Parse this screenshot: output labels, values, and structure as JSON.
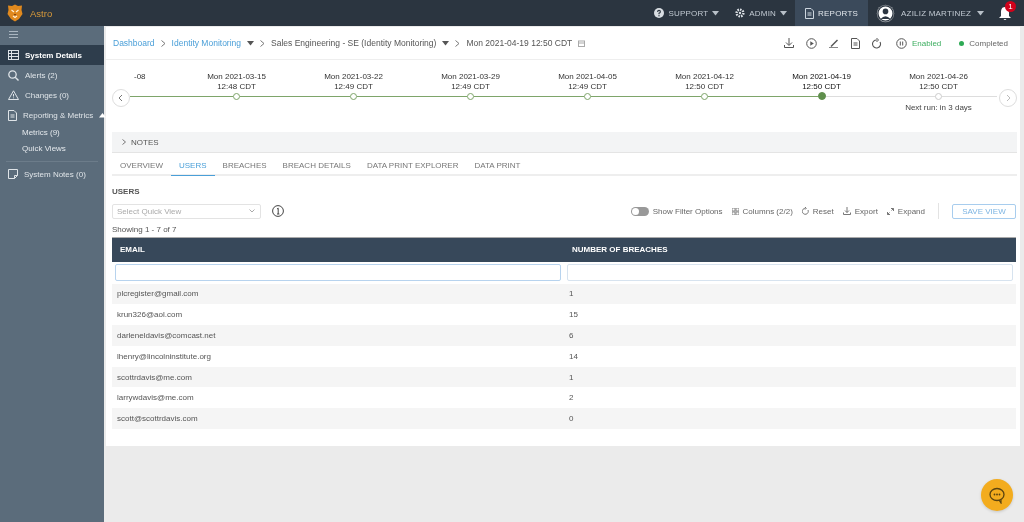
{
  "topbar": {
    "app_name": "Astro",
    "nav": [
      {
        "label": "SUPPORT",
        "kind": "help",
        "selected": false,
        "dropdown": true
      },
      {
        "label": "ADMIN",
        "kind": "gear",
        "selected": false,
        "dropdown": true
      },
      {
        "label": "REPORTS",
        "kind": "report",
        "selected": true,
        "dropdown": false
      }
    ],
    "user": "AZILIZ MARTINEZ",
    "notification_count": "1"
  },
  "sidebar": {
    "items": [
      {
        "label": "System Details",
        "selected": true
      },
      {
        "label": "Alerts (2)",
        "selected": false
      },
      {
        "label": "Changes (0)",
        "selected": false
      },
      {
        "label": "Reporting & Metrics",
        "selected": false,
        "expanded": true,
        "children": [
          {
            "label": "Metrics (9)",
            "selected": false
          },
          {
            "label": "Quick Views",
            "selected": false
          }
        ]
      },
      {
        "label": "System Notes (0)",
        "selected": false
      }
    ]
  },
  "breadcrumb": [
    {
      "label": "Dashboard",
      "link": true,
      "dropdown": false
    },
    {
      "label": "Identity Monitoring",
      "link": true,
      "dropdown": true
    },
    {
      "label": "Sales Engineering - SE (Identity Monitoring)",
      "link": false,
      "dropdown": true
    },
    {
      "label": "Mon 2021-04-19 12:50 CDT",
      "link": false,
      "dropdown": false
    }
  ],
  "status": {
    "enabled": "Enabled",
    "state": "Completed"
  },
  "timeline": [
    {
      "date": "-08",
      "completed": true,
      "selected": false,
      "partial": true
    },
    {
      "date": "Mon 2021-03-15",
      "time": "12:48 CDT",
      "completed": true,
      "selected": false
    },
    {
      "date": "Mon 2021-03-22",
      "time": "12:49 CDT",
      "completed": true,
      "selected": false
    },
    {
      "date": "Mon 2021-03-29",
      "time": "12:49 CDT",
      "completed": true,
      "selected": false
    },
    {
      "date": "Mon 2021-04-05",
      "time": "12:49 CDT",
      "completed": true,
      "selected": false
    },
    {
      "date": "Mon 2021-04-12",
      "time": "12:50 CDT",
      "completed": true,
      "selected": false
    },
    {
      "date": "Mon 2021-04-19",
      "time": "12:50 CDT",
      "completed": true,
      "selected": true
    },
    {
      "date": "Mon 2021-04-26",
      "time": "12:50 CDT",
      "completed": false,
      "selected": false,
      "note": "Next run: in 3 days"
    }
  ],
  "notes": {
    "label": "NOTES",
    "expanded": false
  },
  "tabs": [
    {
      "label": "OVERVIEW",
      "selected": false
    },
    {
      "label": "USERS",
      "selected": true
    },
    {
      "label": "BREACHES",
      "selected": false
    },
    {
      "label": "BREACH DETAILS",
      "selected": false
    },
    {
      "label": "DATA PRINT EXPLORER",
      "selected": false
    },
    {
      "label": "DATA PRINT",
      "selected": false
    }
  ],
  "section_title": "USERS",
  "quick_view": {
    "placeholder": "Select Quick View"
  },
  "toolbar": {
    "filter_toggle": {
      "label": "Show Filter Options",
      "on": false
    },
    "columns": "Columns (2/2)",
    "reset": "Reset",
    "export": "Export",
    "expand": "Expand",
    "save": "SAVE VIEW"
  },
  "showing": "Showing 1 - 7 of 7",
  "table": {
    "columns": [
      "EMAIL",
      "NUMBER OF BREACHES"
    ],
    "rows": [
      [
        "plcregister@gmail.com",
        "1"
      ],
      [
        "krun326@aol.com",
        "15"
      ],
      [
        "darleneldavis@comcast.net",
        "6"
      ],
      [
        "lhenry@lincolninstitute.org",
        "14"
      ],
      [
        "scottrdavis@me.com",
        "1"
      ],
      [
        "larrywdavis@me.com",
        "2"
      ],
      [
        "scott@scottrdavis.com",
        "0"
      ]
    ]
  }
}
